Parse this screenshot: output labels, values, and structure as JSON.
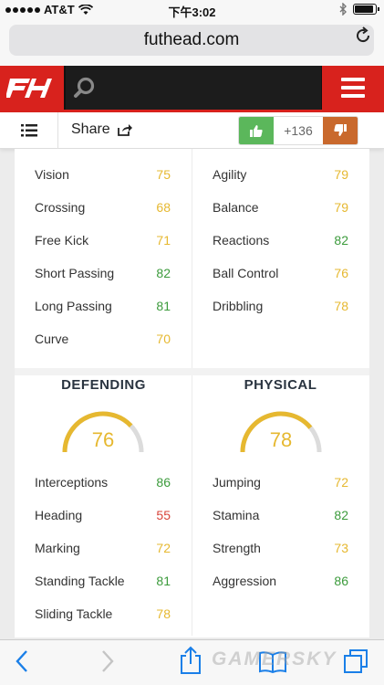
{
  "status_bar": {
    "carrier": "AT&T",
    "time": "下午3:02",
    "battery_level": 0.9
  },
  "browser": {
    "url": "futhead.com"
  },
  "site": {
    "logo_text": "FH",
    "brand_color": "#d8221d"
  },
  "share_bar": {
    "share_label": "Share",
    "vote_count": "+136"
  },
  "stats_top_left": [
    {
      "label": "Vision",
      "value": "75",
      "color": "yellow"
    },
    {
      "label": "Crossing",
      "value": "68",
      "color": "yellow"
    },
    {
      "label": "Free Kick",
      "value": "71",
      "color": "yellow"
    },
    {
      "label": "Short Passing",
      "value": "82",
      "color": "green"
    },
    {
      "label": "Long Passing",
      "value": "81",
      "color": "green"
    },
    {
      "label": "Curve",
      "value": "70",
      "color": "yellow"
    }
  ],
  "stats_top_right": [
    {
      "label": "Agility",
      "value": "79",
      "color": "yellow"
    },
    {
      "label": "Balance",
      "value": "79",
      "color": "yellow"
    },
    {
      "label": "Reactions",
      "value": "82",
      "color": "green"
    },
    {
      "label": "Ball Control",
      "value": "76",
      "color": "yellow"
    },
    {
      "label": "Dribbling",
      "value": "78",
      "color": "yellow"
    }
  ],
  "defending": {
    "title": "DEFENDING",
    "rating": "76",
    "rating_fraction": 0.76,
    "stats": [
      {
        "label": "Interceptions",
        "value": "86",
        "color": "green"
      },
      {
        "label": "Heading",
        "value": "55",
        "color": "red"
      },
      {
        "label": "Marking",
        "value": "72",
        "color": "yellow"
      },
      {
        "label": "Standing Tackle",
        "value": "81",
        "color": "green"
      },
      {
        "label": "Sliding Tackle",
        "value": "78",
        "color": "yellow"
      }
    ]
  },
  "physical": {
    "title": "PHYSICAL",
    "rating": "78",
    "rating_fraction": 0.78,
    "stats": [
      {
        "label": "Jumping",
        "value": "72",
        "color": "yellow"
      },
      {
        "label": "Stamina",
        "value": "82",
        "color": "green"
      },
      {
        "label": "Strength",
        "value": "73",
        "color": "yellow"
      },
      {
        "label": "Aggression",
        "value": "86",
        "color": "green"
      }
    ]
  },
  "colors": {
    "green": "#3c9b3c",
    "yellow": "#e6b830",
    "red": "#d8433a",
    "vote_up": "#5bb75b",
    "vote_down": "#c9692d"
  },
  "watermark": "GAMERSKY"
}
